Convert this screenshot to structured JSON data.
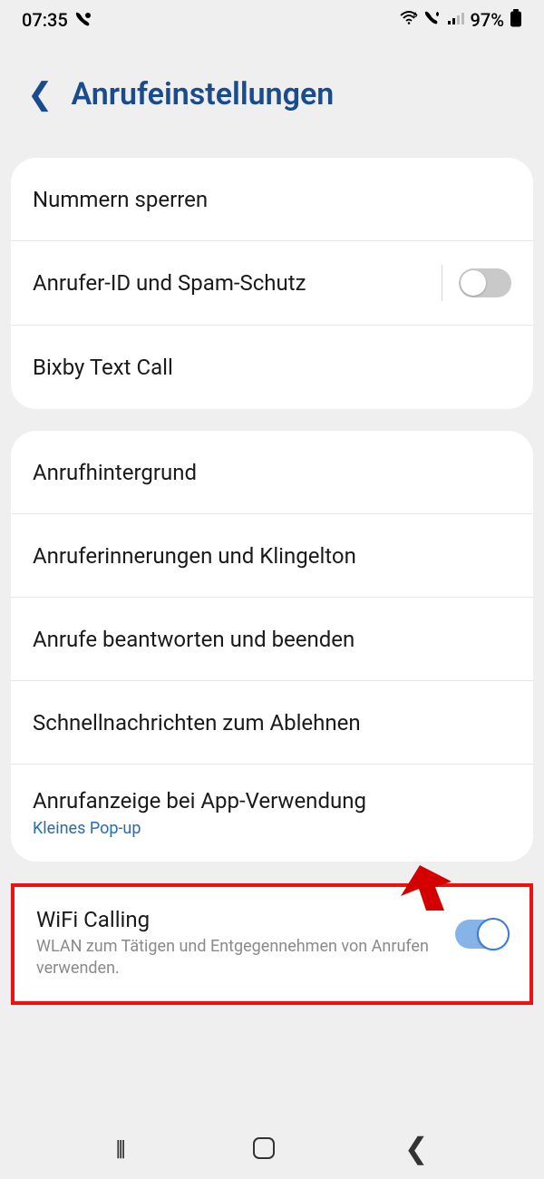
{
  "status": {
    "time": "07:35",
    "battery": "97%"
  },
  "header": {
    "title": "Anrufeinstellungen"
  },
  "group1": {
    "items": [
      {
        "title": "Nummern sperren"
      },
      {
        "title": "Anrufer-ID und Spam-Schutz",
        "toggle": "off"
      },
      {
        "title": "Bixby Text Call"
      }
    ]
  },
  "group2": {
    "items": [
      {
        "title": "Anrufhintergrund"
      },
      {
        "title": "Anruferinnerungen und Klingelton"
      },
      {
        "title": "Anrufe beantworten und beenden"
      },
      {
        "title": "Schnellnachrichten zum Ablehnen"
      },
      {
        "title": "Anrufanzeige bei App-Verwendung",
        "sub": "Kleines Pop-up"
      }
    ]
  },
  "highlight": {
    "title": "WiFi Calling",
    "desc": "WLAN zum Tätigen und Entgegennehmen von Anrufen verwenden.",
    "toggle": "on"
  }
}
